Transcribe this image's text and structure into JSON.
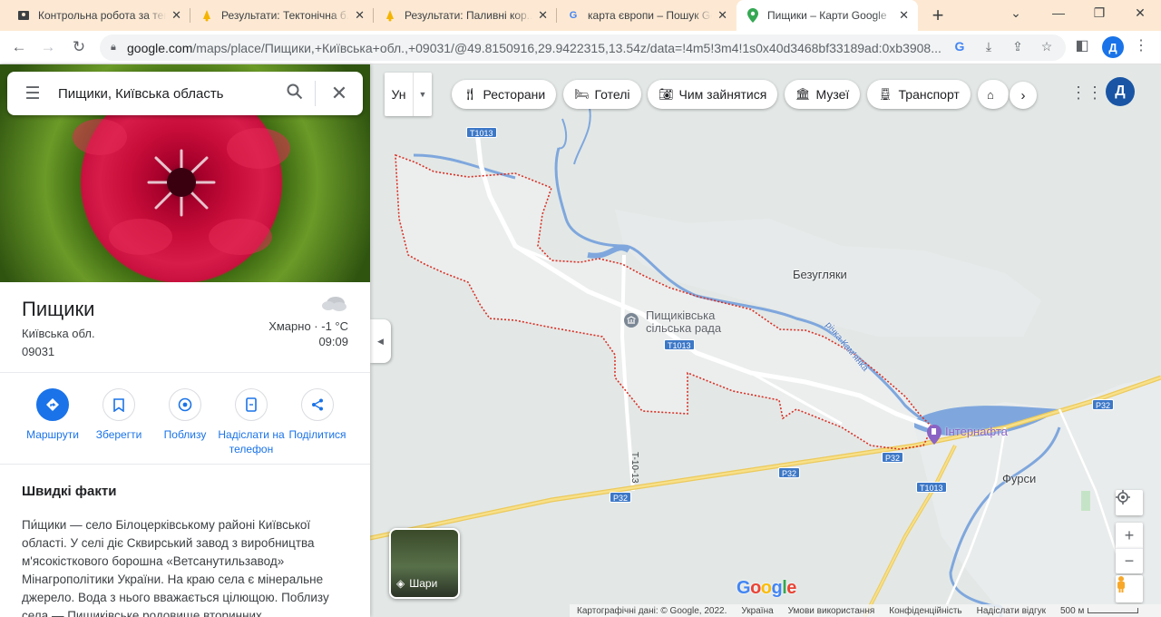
{
  "browser": {
    "tabs": [
      {
        "title": "Контрольна робота за тему...",
        "icon": "classroom-icon"
      },
      {
        "title": "Результати: Тектонічна б...",
        "icon": "bell-icon"
      },
      {
        "title": "Результати: Паливні кор...",
        "icon": "bell-icon"
      },
      {
        "title": "карта європи – Пошук Google",
        "icon": "google-icon"
      },
      {
        "title": "Пищики – Карти Google",
        "icon": "maps-pin-icon",
        "active": true
      }
    ],
    "url_host": "google.com",
    "url_rest": "/maps/place/Пищики,+Київська+обл.,+09031/@49.8150916,29.9422315,13.54z/data=!4m5!3m4!1s0x40d3468bf33189ad:0xb3908...",
    "profile_letter": "Д"
  },
  "search": {
    "query": "Пищики, Київська область"
  },
  "place": {
    "name": "Пищики",
    "region": "Київська обл.",
    "postcode": "09031",
    "weather": "Хмарно · -1 °C",
    "time": "09:09"
  },
  "actions": [
    {
      "label": "Маршрути",
      "icon": "directions-icon"
    },
    {
      "label": "Зберегти",
      "icon": "bookmark-icon"
    },
    {
      "label": "Поблизу",
      "icon": "nearby-icon"
    },
    {
      "label": "Надіслати на телефон",
      "icon": "send-to-phone-icon"
    },
    {
      "label": "Поділитися",
      "icon": "share-icon"
    }
  ],
  "facts": {
    "title": "Швидкі факти",
    "text": "Пи́щики — село Білоцерківському районі Київської області. У селі діє Сквирський завод з виробництва м'ясокісткового борошна «Ветсанутильзавод» Мінагрополітики України. На краю села є мінеральне джерело. Вода з нього вважається цілющою. Поблизу села — Пищиківське родовище вторинних"
  },
  "map": {
    "language_button": "Ун",
    "chips": [
      {
        "label": "Ресторани",
        "icon": "restaurant-icon"
      },
      {
        "label": "Готелі",
        "icon": "hotel-icon"
      },
      {
        "label": "Чим зайнятися",
        "icon": "camera-icon"
      },
      {
        "label": "Музеї",
        "icon": "museum-icon"
      },
      {
        "label": "Транспорт",
        "icon": "transit-icon"
      }
    ],
    "avatar_letter": "Д",
    "labels": {
      "bezuhlyaky": "Безугляки",
      "fursy": "Фурси",
      "council_line1": "Пищиківська",
      "council_line2": "сільська рада",
      "internafta": "Інтернафта",
      "river": "річка Кам'янка"
    },
    "road_shields": {
      "t1013_a": "T1013",
      "t1013_b": "T1013",
      "t1013_c": "T1013",
      "p32_a": "P32",
      "p32_b": "P32",
      "p32_c": "P32",
      "p32_d": "P32",
      "t1013_vertical": "T-10-13"
    },
    "layers_label": "Шари",
    "google_logo": "Google",
    "footer": {
      "data": "Картографічні дані: © Google, 2022.",
      "country": "Україна",
      "terms": "Умови використання",
      "privacy": "Конфіденційність",
      "feedback": "Надіслати відгук",
      "scale": "500 м"
    }
  }
}
